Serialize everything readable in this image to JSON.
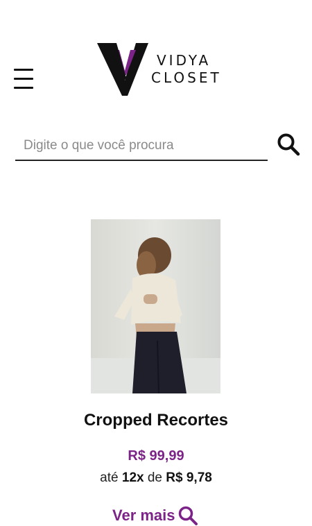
{
  "header": {
    "menu_icon": "hamburger-menu-icon",
    "logo": {
      "word1": "VIDYA",
      "word2": "CLOSET",
      "accent_color": "#7b2386"
    }
  },
  "search": {
    "placeholder": "Digite o que você procura",
    "value": "",
    "icon": "search-icon"
  },
  "product": {
    "name": "Cropped Recortes",
    "price": "R$ 99,99",
    "installments": {
      "prefix": "até",
      "count": "12x",
      "middle": "de",
      "amount": "R$ 9,78"
    },
    "more_label": "Ver mais",
    "more_icon": "search-icon"
  },
  "colors": {
    "accent": "#7b2386",
    "text": "#111111",
    "placeholder": "#8a8a8a"
  }
}
